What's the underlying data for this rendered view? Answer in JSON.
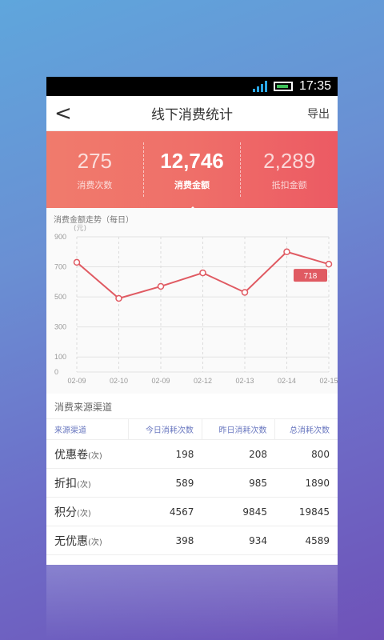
{
  "status_bar": {
    "time": "17:35"
  },
  "nav": {
    "back_icon": "<",
    "title": "线下消费统计",
    "export_label": "导出"
  },
  "stats": [
    {
      "value": "275",
      "label": "消费次数"
    },
    {
      "value": "12,746",
      "label": "消费金额"
    },
    {
      "value": "2,289",
      "label": "抵扣金额"
    }
  ],
  "chart": {
    "title": "消费金额走势（每日）",
    "unit": "(元)",
    "callout": "718"
  },
  "chart_data": {
    "type": "line",
    "title": "消费金额走势（每日）",
    "ylabel": "(元)",
    "categories": [
      "02-09",
      "02-10",
      "02-09",
      "02-12",
      "02-13",
      "02-14",
      "02-15"
    ],
    "values": [
      730,
      490,
      570,
      660,
      530,
      800,
      718
    ],
    "yticks": [
      0,
      100,
      300,
      500,
      700,
      900
    ],
    "ylim": [
      0,
      900
    ],
    "grid": true,
    "color": "#e05a62"
  },
  "table": {
    "section_title": "消费来源渠道",
    "headers": [
      "来源渠道",
      "今日消耗次数",
      "昨日消耗次数",
      "总消耗次数"
    ],
    "rows": [
      {
        "name": "优惠卷",
        "unit": "(次)",
        "today": "198",
        "yesterday": "208",
        "total": "800"
      },
      {
        "name": "折扣",
        "unit": "(次)",
        "today": "589",
        "yesterday": "985",
        "total": "1890"
      },
      {
        "name": "积分",
        "unit": "(次)",
        "today": "4567",
        "yesterday": "9845",
        "total": "19845"
      },
      {
        "name": "无优惠",
        "unit": "(次)",
        "today": "398",
        "yesterday": "934",
        "total": "4589"
      }
    ]
  }
}
